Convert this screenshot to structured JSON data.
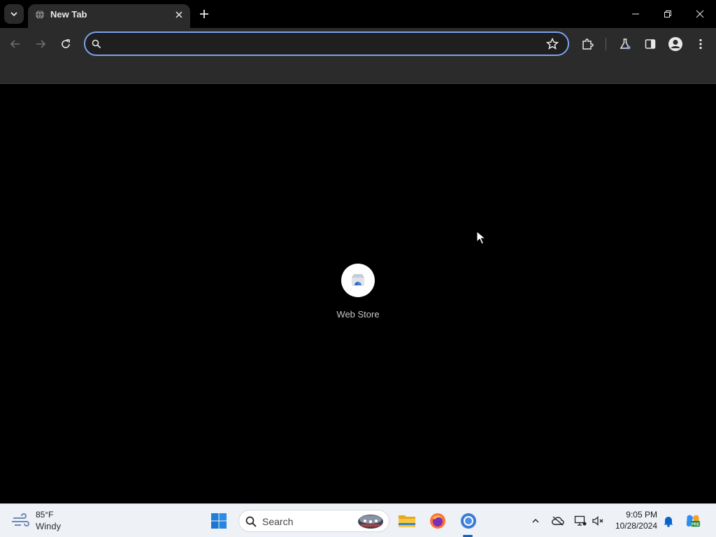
{
  "browser": {
    "tab": {
      "title": "New Tab"
    },
    "omnibox": {
      "value": "",
      "placeholder": ""
    }
  },
  "content": {
    "shortcuts": [
      {
        "label": "Web Store"
      }
    ]
  },
  "taskbar": {
    "weather": {
      "temp": "85°F",
      "condition": "Windy"
    },
    "search": {
      "label": "Search"
    },
    "clock": {
      "time": "9:05 PM",
      "date": "10/28/2024"
    }
  },
  "colors": {
    "accent": "#7ca3ec",
    "toolbar_bg": "#2b2b2b",
    "taskbar_bg": "#eef1f6"
  }
}
